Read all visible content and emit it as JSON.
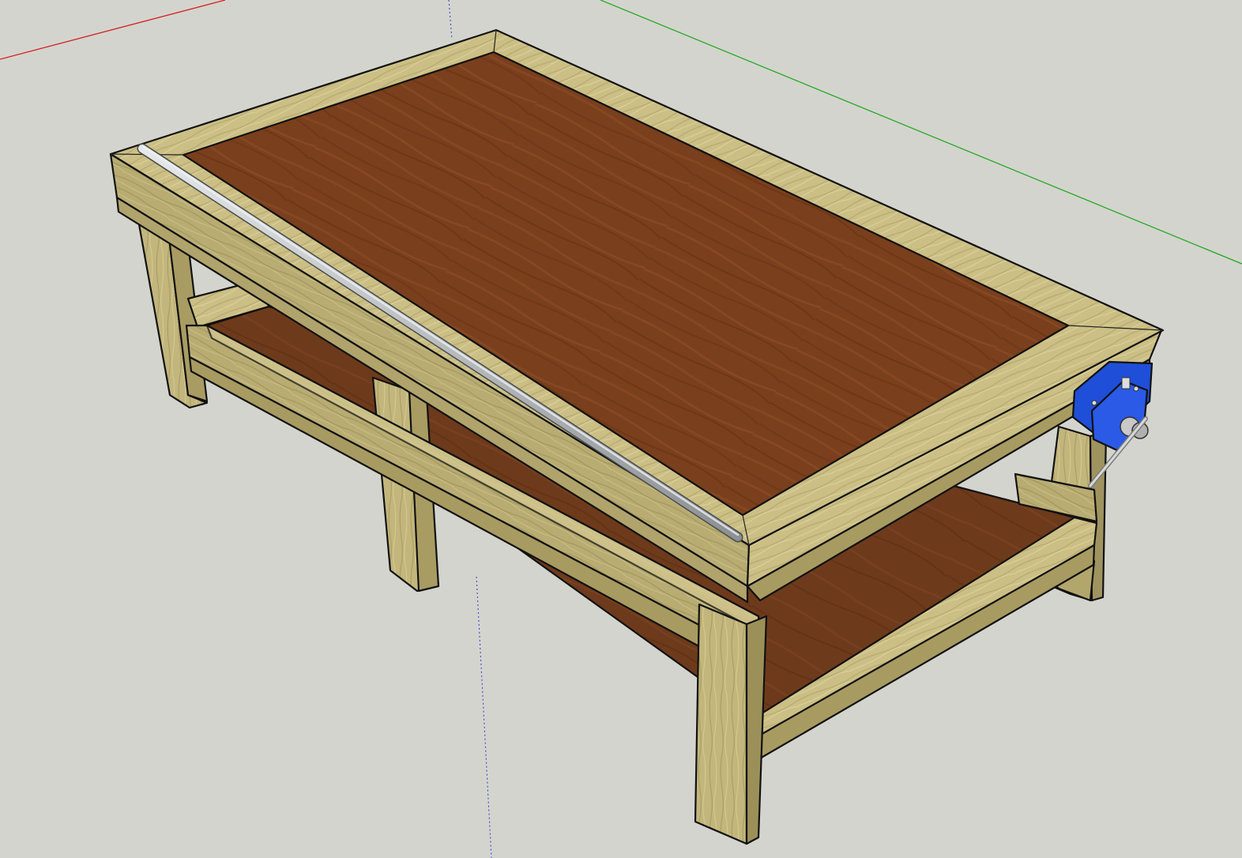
{
  "model": {
    "subject": "workbench",
    "components": [
      "tabletop",
      "frame-rails",
      "legs",
      "lower-shelf",
      "stretchers",
      "pipe-rod",
      "bench-vise"
    ]
  },
  "colors": {
    "background": "#d4d4ce",
    "wood_frame": "#cbbf85",
    "wood_frame_dark": "#b0a46c",
    "wood_frame_shadow": "#9c915c",
    "plywood_top": "#7a3f1d",
    "plywood_shelf": "#6e3a1c",
    "vise": "#1f4fd8",
    "rod": "#c4c8ca",
    "axis_red": "#d22222",
    "axis_green": "#22aa22",
    "axis_blue": "#3a4ad0",
    "edge": "#111111"
  }
}
